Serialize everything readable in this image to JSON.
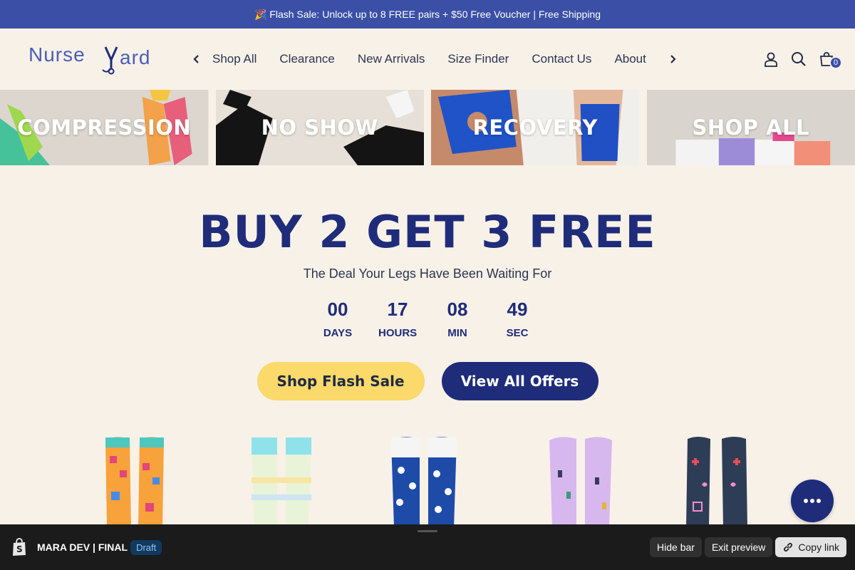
{
  "announcement": "🎉 Flash Sale: Unlock up to 8 FREE pairs + $50 Free Voucher | Free Shipping",
  "brand": {
    "name_part1": "Nurse",
    "name_part2": "ard",
    "logo_letter": "Y"
  },
  "nav": {
    "prev_icon": "chevron-left-icon",
    "next_icon": "chevron-right-icon",
    "items": [
      {
        "label": "Shop All"
      },
      {
        "label": "Clearance"
      },
      {
        "label": "New Arrivals"
      },
      {
        "label": "Size Finder"
      },
      {
        "label": "Contact Us"
      },
      {
        "label": "About"
      }
    ]
  },
  "header_icons": {
    "account": "user-icon",
    "search": "search-icon",
    "cart": "bag-icon",
    "cart_count": "0"
  },
  "categories": [
    {
      "label": "COMPRESSION"
    },
    {
      "label": "NO SHOW"
    },
    {
      "label": "RECOVERY"
    },
    {
      "label": "SHOP ALL"
    }
  ],
  "hero": {
    "title": "BUY 2 GET 3 FREE",
    "subtitle": "The Deal Your Legs Have Been Waiting For",
    "countdown": [
      {
        "value": "00",
        "label": "DAYS"
      },
      {
        "value": "17",
        "label": "HOURS"
      },
      {
        "value": "08",
        "label": "MIN"
      },
      {
        "value": "49",
        "label": "SEC"
      }
    ],
    "primary_button": "Shop Flash Sale",
    "secondary_button": "View All Offers"
  },
  "colors": {
    "announcement_bg": "#3a4fa5",
    "navy": "#1f2c7a",
    "cream": "#f8f1e8",
    "yellow": "#fbd96a"
  },
  "preview_bar": {
    "store": "MARA DEV | FINAL",
    "status": "Draft",
    "hide_bar": "Hide bar",
    "exit_preview": "Exit preview",
    "copy_link": "Copy link"
  }
}
